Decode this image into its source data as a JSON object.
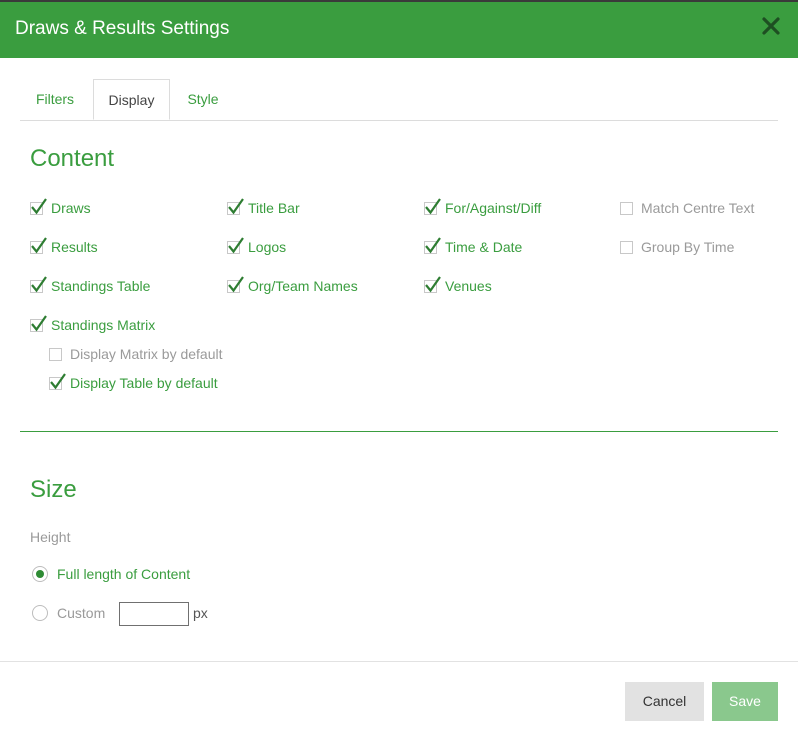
{
  "dialog": {
    "title": "Draws & Results Settings",
    "close_icon": "close-icon"
  },
  "tabs": [
    {
      "label": "Filters",
      "active": false
    },
    {
      "label": "Display",
      "active": true
    },
    {
      "label": "Style",
      "active": false
    }
  ],
  "content": {
    "heading": "Content",
    "options": {
      "draws": {
        "label": "Draws",
        "checked": true
      },
      "results": {
        "label": "Results",
        "checked": true
      },
      "standings_table": {
        "label": "Standings Table",
        "checked": true
      },
      "standings_matrix": {
        "label": "Standings Matrix",
        "checked": true
      },
      "display_matrix_default": {
        "label": "Display Matrix by default",
        "checked": false
      },
      "display_table_default": {
        "label": "Display Table by default",
        "checked": true
      },
      "title_bar": {
        "label": "Title Bar",
        "checked": true
      },
      "logos": {
        "label": "Logos",
        "checked": true
      },
      "org_team_names": {
        "label": "Org/Team Names",
        "checked": true
      },
      "for_against_diff": {
        "label": "For/Against/Diff",
        "checked": true
      },
      "time_date": {
        "label": "Time & Date",
        "checked": true
      },
      "venues": {
        "label": "Venues",
        "checked": true
      },
      "match_centre_text": {
        "label": "Match Centre Text",
        "checked": false
      },
      "group_by_time": {
        "label": "Group By Time",
        "checked": false
      }
    }
  },
  "size": {
    "heading": "Size",
    "height_label": "Height",
    "full_length_label": "Full length of Content",
    "full_length_selected": true,
    "custom_label": "Custom",
    "custom_selected": false,
    "custom_value": "",
    "unit": "px"
  },
  "footer": {
    "cancel_label": "Cancel",
    "save_label": "Save"
  },
  "colors": {
    "accent": "#3a9d3f",
    "header_bg": "#3a9d3f",
    "save_bg": "#8ac88d",
    "cancel_bg": "#e2e2e2",
    "disabled_text": "#9a9a9a"
  }
}
